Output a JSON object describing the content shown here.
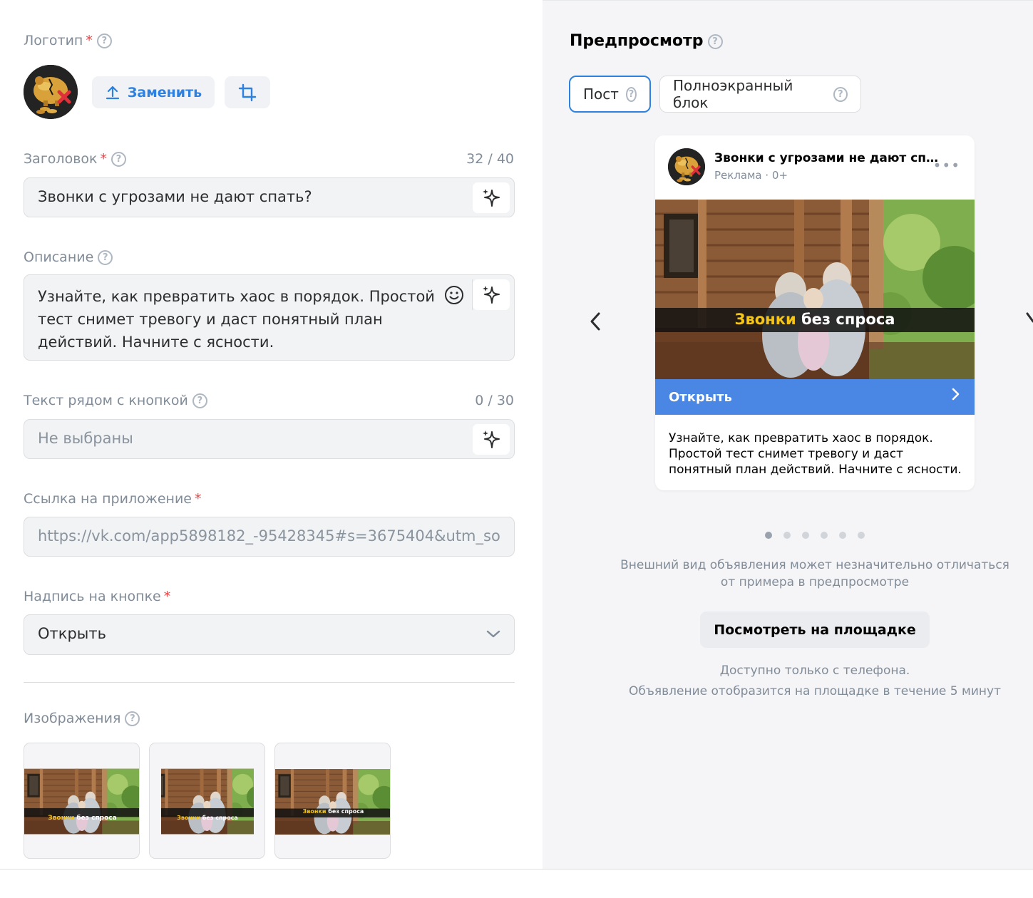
{
  "form": {
    "logo": {
      "label": "Логотип",
      "required_mark": "*",
      "replace_label": "Заменить"
    },
    "headline": {
      "label": "Заголовок",
      "required_mark": "*",
      "counter": "32 / 40",
      "value": "Звонки с угрозами не дают спать?"
    },
    "description": {
      "label": "Описание",
      "value": "Узнайте, как превратить хаос в порядок. Простой тест снимет тревогу и даст понятный план действий. Начните с ясности."
    },
    "button_text": {
      "label": "Текст рядом с кнопкой",
      "counter": "0 / 30",
      "placeholder": "Не выбраны"
    },
    "app_link": {
      "label": "Ссылка на приложение",
      "required_mark": "*",
      "value": "https://vk.com/app5898182_-95428345#s=3675404&utm_sou"
    },
    "cta_label": {
      "label": "Надпись на кнопке",
      "required_mark": "*",
      "value": "Открыть"
    },
    "images": {
      "label": "Изображения",
      "banner_highlight": "Звонки",
      "banner_rest": " без спроса"
    }
  },
  "preview": {
    "title": "Предпросмотр",
    "tabs": [
      {
        "label": "Пост",
        "active": true
      },
      {
        "label": "Полноэкранный блок",
        "active": false
      }
    ],
    "card": {
      "title": "Звонки с угрозами не дают спат...",
      "subtitle": "Реклама · 0+",
      "more": "•••",
      "banner_highlight": "Звонки",
      "banner_rest": " без спроса",
      "cta": "Открыть",
      "description": "Узнайте, как превратить хаос в порядок. Простой тест снимет тревогу и даст понятный план действий. Начните с ясности."
    },
    "dots_total": 6,
    "dots_active": 0,
    "note": "Внешний вид объявления может незначительно отличаться от примера в предпросмотре",
    "view_button": "Посмотреть на площадке",
    "availability_line1": "Доступно только с телефона.",
    "availability_line2": "Объявление отобразится на площадке в течение 5 минут"
  },
  "colors": {
    "accent": "#2d81e0",
    "cta": "#4a86e4",
    "required": "#e64646",
    "banner_highlight": "#f5c518"
  },
  "icons": [
    "help-icon",
    "upload-icon",
    "crop-icon",
    "sparkle-icon",
    "emoji-icon",
    "chevron-down-icon",
    "chevron-left-icon",
    "chevron-right-icon",
    "more-icon"
  ]
}
